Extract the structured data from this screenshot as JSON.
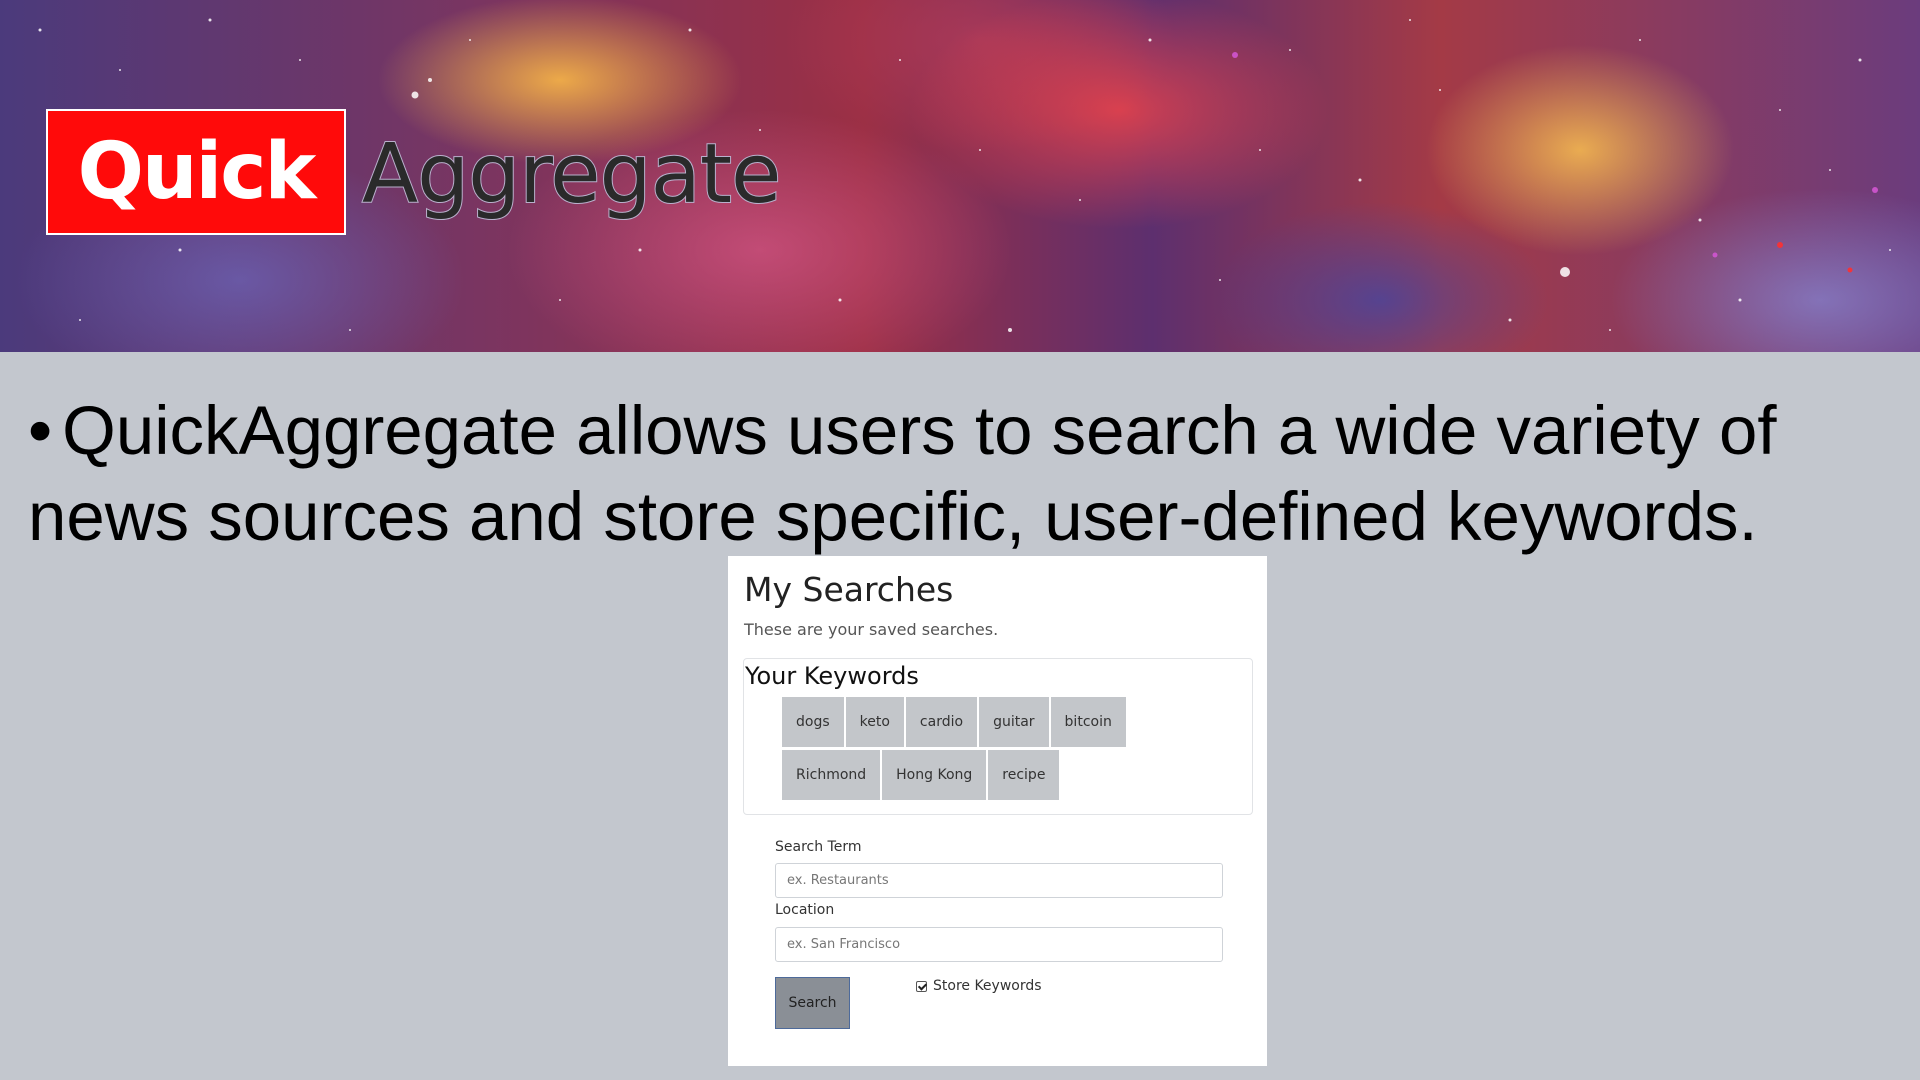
{
  "banner": {
    "logo_quick": "Quick",
    "logo_aggregate": "Aggregate"
  },
  "slide": {
    "bullet": "•",
    "text": "QuickAggregate allows users to search a wide variety of news sources and store specific, user-defined keywords."
  },
  "panel": {
    "title": "My Searches",
    "subtitle": "These are your saved searches.",
    "keywords_title": "Your Keywords",
    "keywords": [
      "dogs",
      "keto",
      "cardio",
      "guitar",
      "bitcoin",
      "Richmond",
      "Hong Kong",
      "recipe"
    ],
    "search_term_label": "Search Term",
    "search_term_placeholder": "ex. Restaurants",
    "location_label": "Location",
    "location_placeholder": "ex. San Francisco",
    "search_button": "Search",
    "store_keywords_label": "Store Keywords",
    "store_keywords_checked": true
  },
  "colors": {
    "logo_red": "#ff0a0a",
    "slide_background": "#c3c7ce",
    "keyword_button": "#c3c6ca",
    "search_button": "#8a8f96"
  }
}
